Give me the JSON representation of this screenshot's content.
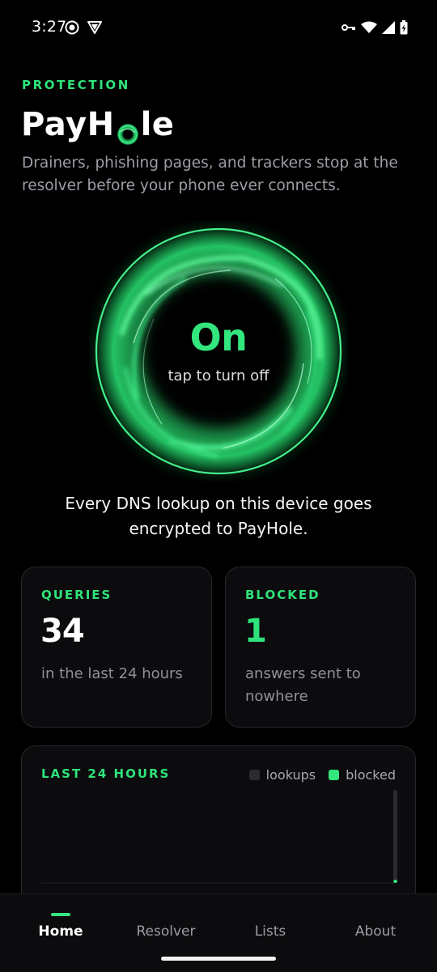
{
  "status_bar": {
    "time": "3:27",
    "left_icons": [
      "record-icon",
      "vpn-shield-icon"
    ],
    "right_icons": [
      "vpn-key-icon",
      "wifi-icon",
      "signal-icon",
      "battery-charging-icon"
    ]
  },
  "header": {
    "eyebrow": "PROTECTION",
    "title_prefix": "PayH",
    "title_suffix": "le",
    "subtitle": "Drainers, phishing pages, and trackers stop at the resolver before your phone ever connects."
  },
  "toggle": {
    "state": "On",
    "hint": "tap to turn off"
  },
  "encrypted_note": "Every DNS lookup on this device goes encrypted to PayHole.",
  "stats": {
    "queries": {
      "label": "QUERIES",
      "value": "34",
      "desc": "in the last 24 hours"
    },
    "blocked": {
      "label": "BLOCKED",
      "value": "1",
      "desc": "answers sent to nowhere"
    }
  },
  "chart": {
    "title": "LAST 24 HOURS",
    "legend": [
      {
        "name": "lookups",
        "color": "#2a2b30"
      },
      {
        "name": "blocked",
        "color": "#35e67e"
      }
    ]
  },
  "chart_data": {
    "type": "bar",
    "title": "LAST 24 HOURS",
    "series": [
      {
        "name": "lookups",
        "values": [
          34
        ]
      },
      {
        "name": "blocked",
        "values": [
          1
        ]
      }
    ]
  },
  "nav": {
    "items": [
      {
        "label": "Home"
      },
      {
        "label": "Resolver"
      },
      {
        "label": "Lists"
      },
      {
        "label": "About"
      }
    ],
    "active": "Home"
  },
  "colors": {
    "accent": "#2ee37a",
    "background": "#000000",
    "card": "#0c0c0e"
  }
}
